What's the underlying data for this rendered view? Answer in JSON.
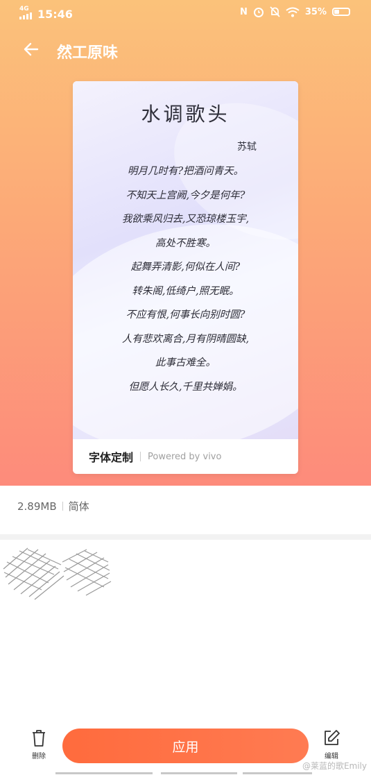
{
  "status_bar": {
    "network": "4G",
    "time": "15:46",
    "nfc": "N",
    "battery": "35%",
    "battery_level": 0.35
  },
  "app_bar": {
    "title": "然工原味"
  },
  "preview": {
    "poem_title": "水调歌头",
    "author": "苏轼",
    "lines": [
      "明月几时有?把酒问青天。",
      "不知天上宫阙,今夕是何年?",
      "我欲乘风归去,又恐琼楼玉宇,",
      "高处不胜寒。",
      "起舞弄清影,何似在人间?",
      "转朱阁,低绮户,照无眠。",
      "不应有恨,何事长向别时圆?",
      "人有悲欢离合,月有阴晴圆缺,",
      "此事古难全。",
      "但愿人长久,千里共婵娟。"
    ]
  },
  "card_footer": {
    "brand": "字体定制",
    "powered": "Powered by vivo"
  },
  "info": {
    "size": "2.89MB",
    "variant": "简体"
  },
  "bottom_bar": {
    "delete_label": "删除",
    "apply_label": "应用",
    "edit_label": "编辑"
  },
  "watermark": "@莱蓝的歌Emily",
  "colors": {
    "accent": "#ff6b3d",
    "hero_top": "#fbc27a",
    "hero_bottom": "#fd8b7b"
  }
}
